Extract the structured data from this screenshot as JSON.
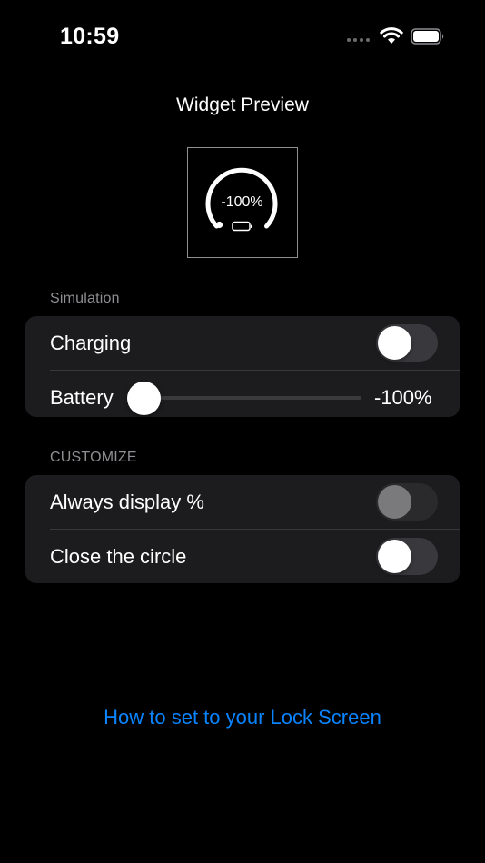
{
  "status_bar": {
    "time": "10:59",
    "icons": [
      "signal-dots-icon",
      "wifi-icon",
      "battery-icon"
    ]
  },
  "header": {
    "title": "Widget Preview"
  },
  "widget": {
    "percent_text": "-100%",
    "ring_icon": "battery-ring",
    "battery_glyph": "battery-outline-icon"
  },
  "simulation": {
    "header": "Simulation",
    "charging": {
      "label": "Charging",
      "on": false
    },
    "battery": {
      "label": "Battery",
      "value_text": "-100%",
      "level": 0
    }
  },
  "customize": {
    "header": "CUSTOMIZE",
    "always_display": {
      "label": "Always display %",
      "on": false,
      "enabled": false
    },
    "close_circle": {
      "label": "Close the circle",
      "on": false,
      "enabled": true
    }
  },
  "help": {
    "link_text": "How to set to your Lock Screen"
  },
  "colors": {
    "background": "#000000",
    "group_background": "#1c1c1e",
    "accent": "#0a84ff",
    "secondary_text": "#8e8e93"
  }
}
